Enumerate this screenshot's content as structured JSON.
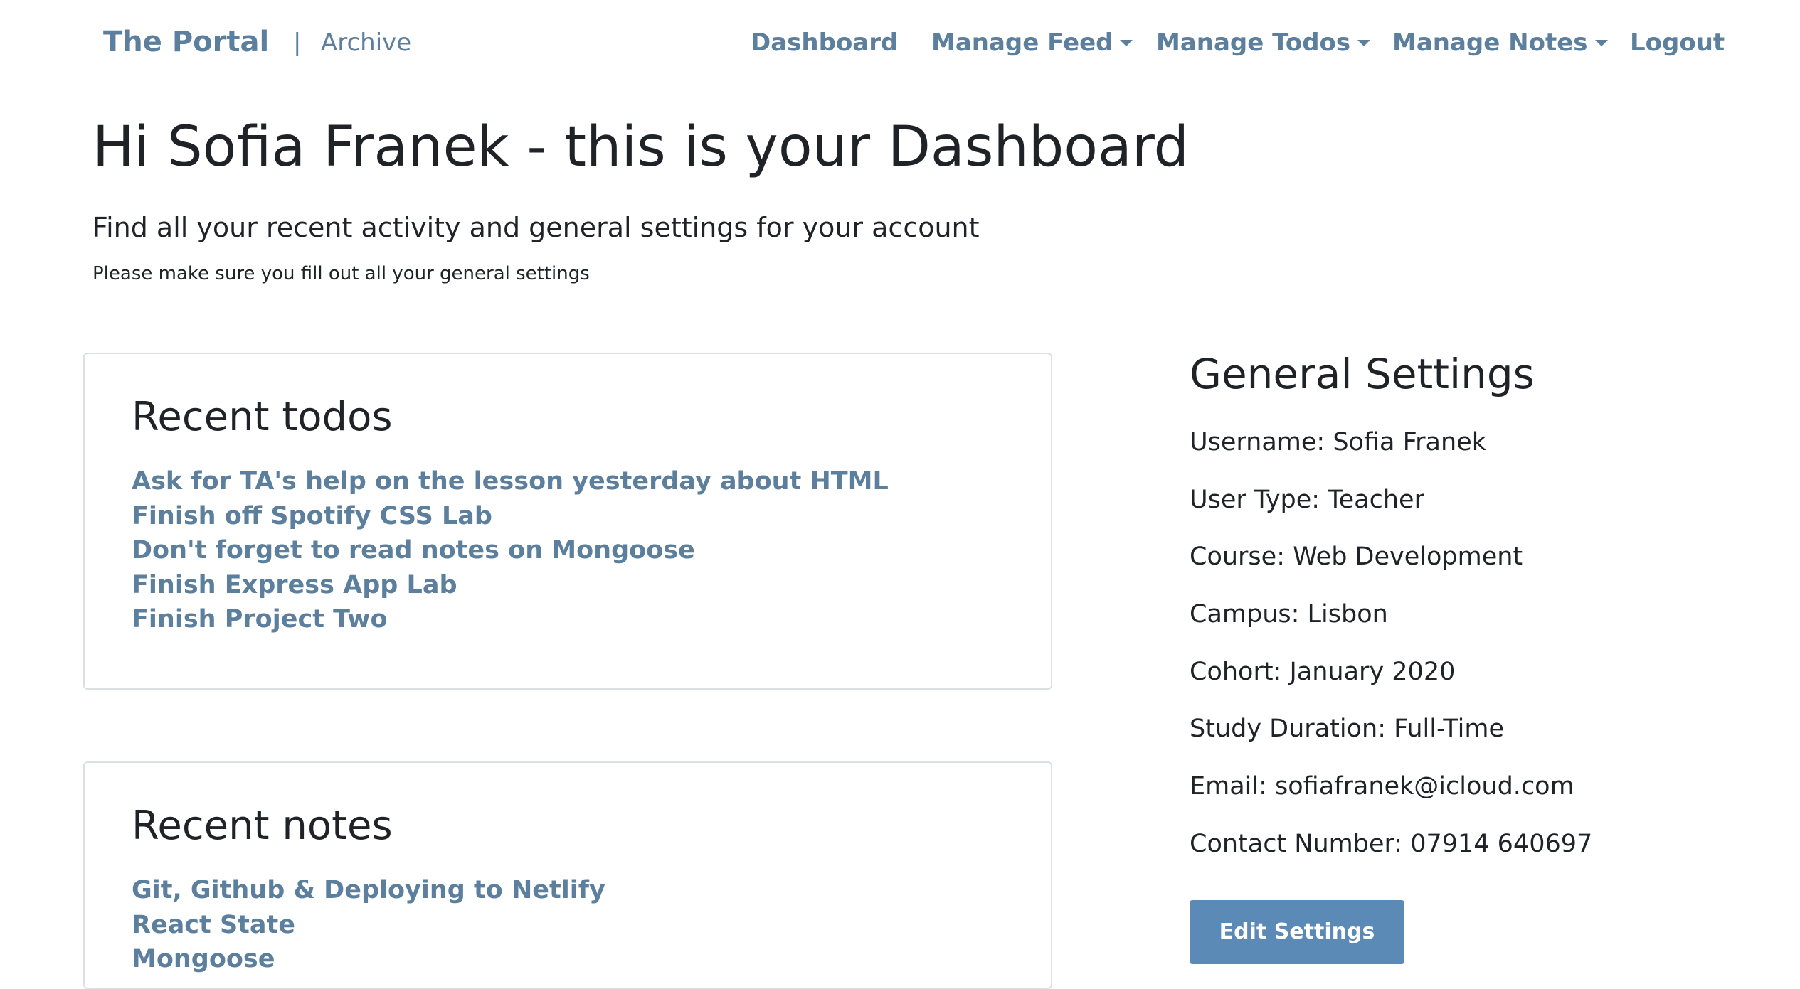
{
  "navbar": {
    "brand": "The Portal",
    "separator": "|",
    "archive": "Archive",
    "items": [
      {
        "label": "Dashboard",
        "dropdown": false
      },
      {
        "label": "Manage Feed",
        "dropdown": true
      },
      {
        "label": "Manage Todos",
        "dropdown": true
      },
      {
        "label": "Manage Notes",
        "dropdown": true
      },
      {
        "label": "Logout",
        "dropdown": false
      }
    ]
  },
  "header": {
    "title": "Hi Sofia Franek - this is your Dashboard",
    "lead": "Find all your recent activity and general settings for your account",
    "note": "Please make sure you fill out all your general settings"
  },
  "todos": {
    "title": "Recent todos",
    "items": [
      "Ask for TA's help on the lesson yesterday about HTML",
      "Finish off Spotify CSS Lab",
      "Don't forget to read notes on Mongoose",
      "Finish Express App Lab",
      "Finish Project Two"
    ]
  },
  "notes": {
    "title": "Recent notes",
    "items": [
      "Git, Github & Deploying to Netlify",
      "React State",
      "Mongoose"
    ]
  },
  "settings": {
    "title": "General Settings",
    "fields": [
      "Username: Sofia Franek",
      "User Type: Teacher",
      "Course: Web Development",
      "Campus: Lisbon",
      "Cohort: January 2020",
      "Study Duration: Full-Time",
      "Email: sofiafranek@icloud.com",
      "Contact Number: 07914 640697"
    ],
    "edit_label": "Edit Settings"
  },
  "colors": {
    "link": "#5b7f9c",
    "button": "#5b8ab7",
    "text": "#1f2328",
    "card_border": "#dcdfe3"
  }
}
